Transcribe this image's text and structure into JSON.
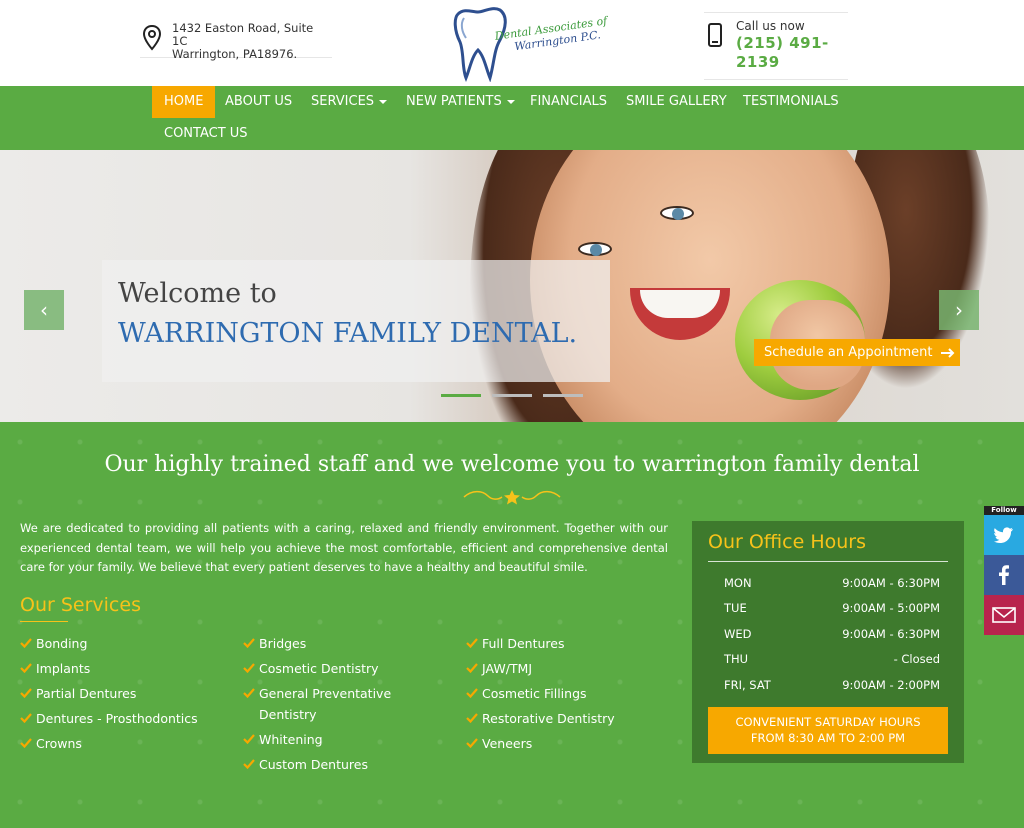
{
  "header": {
    "address_line1": "1432 Easton Road, Suite 1C",
    "address_line2": "Warrington, PA18976.",
    "logo_line1": "Dental Associates of",
    "logo_line2": "Warrington P.C.",
    "call_label": "Call us now",
    "phone": "(215) 491-2139"
  },
  "nav": {
    "home": "HOME",
    "about": "ABOUT US",
    "services": "SERVICES",
    "new_patients": "NEW PATIENTS",
    "financials": "FINANCIALS",
    "smile_gallery": "SMILE GALLERY",
    "testimonials": "TESTIMONIALS",
    "contact": "CONTACT US"
  },
  "hero": {
    "welcome": "Welcome to",
    "practice": "WARRINGTON FAMILY DENTAL.",
    "schedule": "Schedule an Appointment",
    "prev": "‹",
    "next": "›"
  },
  "main": {
    "headline": "Our highly trained staff and we welcome you to warrington family dental",
    "intro": "We are dedicated to providing all patients with a caring, relaxed and friendly environment. Together with our experienced dental team, we will help you achieve the most comfortable, efficient and comprehensive dental care for your family. We believe that every patient deserves to have a healthy and beautiful smile.",
    "services_title": "Our Services",
    "services_col1": [
      "Bonding",
      "Implants",
      "Partial Dentures",
      "Dentures - Prosthodontics",
      "Crowns"
    ],
    "services_col2": [
      "Bridges",
      "Cosmetic Dentistry",
      "General Preventative Dentistry",
      "Whitening",
      "Custom Dentures"
    ],
    "services_col3": [
      "Full Dentures",
      "JAW/TMJ",
      "Cosmetic Fillings",
      "Restorative Dentistry",
      "Veneers"
    ]
  },
  "hours": {
    "title": "Our Office Hours",
    "rows": [
      {
        "day": "MON",
        "time": "9:00AM - 6:30PM"
      },
      {
        "day": "TUE",
        "time": "9:00AM - 5:00PM"
      },
      {
        "day": "WED",
        "time": "9:00AM - 6:30PM"
      },
      {
        "day": "THU",
        "time": "- Closed"
      },
      {
        "day": "FRI, SAT",
        "time": "9:00AM - 2:00PM"
      }
    ],
    "saturday_line1": "CONVENIENT SATURDAY HOURS",
    "saturday_line2": "FROM 8:30 AM TO 2:00 PM"
  },
  "social": {
    "follow": "Follow"
  },
  "colors": {
    "brand_green": "#5aab43",
    "accent_orange": "#f7a800",
    "hours_bg": "#3e7a2d",
    "title_yellow": "#f7c21a",
    "headline_blue": "#2e6bb0",
    "twitter": "#29a9e1",
    "facebook": "#3b5998",
    "email": "#b8244d"
  },
  "icons": [
    "map-pin-icon",
    "phone-icon",
    "tooth-logo-icon",
    "check-icon",
    "twitter-icon",
    "facebook-icon",
    "email-icon",
    "arrow-right-icon"
  ]
}
